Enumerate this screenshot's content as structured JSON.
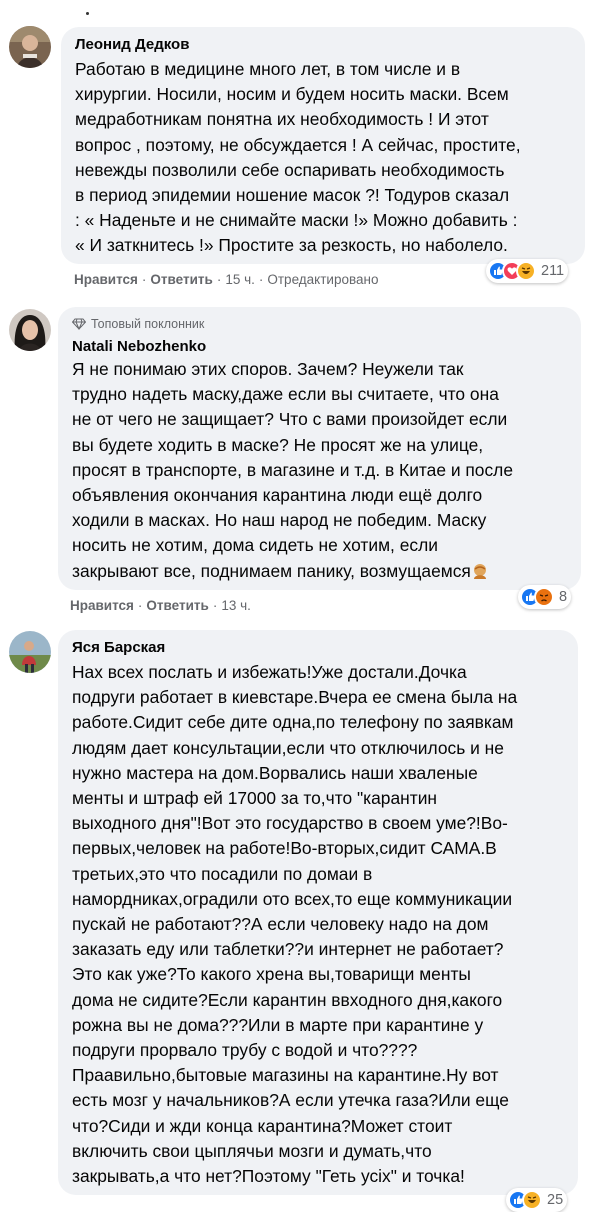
{
  "comments": [
    {
      "author": "Леонид Дедков",
      "text": "Работаю в медицине много лет, в том числе и в\nхирургии. Носили, носим и будем носить маски. Всем\nмедработникам понятна их необходимость ! И этот\nвопрос , поэтому, не обсуждается ! А сейчас, простите,\nневежды позволили себе оспаривать необходимость\nв период эпидемии ношение масок ?! Тодуров сказал\n: « Наденьте и не снимайте маски !» Можно добавить :\n« И заткнитесь !» Простите за резкость, но наболело.",
      "like_label": "Нравится",
      "reply_label": "Ответить",
      "time": "15 ч.",
      "edited": "Отредактировано",
      "reaction_icons": [
        "like-icon",
        "love-icon",
        "haha-icon"
      ],
      "reaction_count": "211"
    },
    {
      "badge": "Топовый поклонник",
      "author": "Natali Nebozhenko",
      "text": "Я не понимаю этих споров. Зачем? Неужели так\nтрудно надеть маску,даже если вы считаете, что она\nне от чего не защищает? Что с вами произойдет если\nвы будете ходить в маске? Не просят же на улице,\nпросят в транспорте, в магазине и т.д. в Китае и после\nобъявления окончания карантина люди ещё долго\nходили в масках. Но наш народ не победим. Маску\nносить не хотим, дома сидеть не хотим, если\nзакрывают все, поднимаем панику, возмущаемся",
      "like_label": "Нравится",
      "reply_label": "Ответить",
      "time": "13 ч.",
      "reaction_icons": [
        "like-icon",
        "angry-icon"
      ],
      "reaction_count": "8"
    },
    {
      "author": "Яся Барская",
      "text": "Нах всех послать и избежать!Уже достали.Дочка\nподруги работает в киевстаре.Вчера ее смена была на\nработе.Сидит себе дите одна,по телефону по заявкам\nлюдям дает консультации,если что отключилось и не\nнужно мастера на дом.Ворвались наши хваленые\nменты и штраф ей 17000 за то,что \"карантин\nвыходного дня\"!Вот это государство в своем уме?!Во-\nпервых,человек на работе!Во-вторых,сидит САМА.В\nтретьих,это что посадили по домаи в\nнамордниках,оградили ото всех,то еще коммуникации\nпускай не работают??А если человеку надо на дом\nзаказать еду или таблетки??и интернет не работает?\nЭто как уже?То какого хрена вы,товарищи менты\nдома не сидите?Если карантин ввходного дня,какого\nрожна вы не дома???Или в марте при карантине у\nподруги прорвало трубу с водой и что????\nПраавильно,бытовые магазины на карантине.Ну вот\nесть мозг у начальников?А если утечка газа?Или еще\nчто?Сиди и жди конца карантина?Может стоит\nвключить свои цыплячьи мозги и думать,что\nзакрывать,а что нет?Поэтому \"Геть усіх\" и точка!",
      "reaction_icons": [
        "like-icon",
        "haha-icon"
      ],
      "reaction_count": "25"
    }
  ],
  "colors": {
    "bubble": "#f0f2f5",
    "meta": "#65676b",
    "like": "#1877f2",
    "love": "#f33e58",
    "haha": "#f7b125",
    "angry": "#e9710f"
  }
}
